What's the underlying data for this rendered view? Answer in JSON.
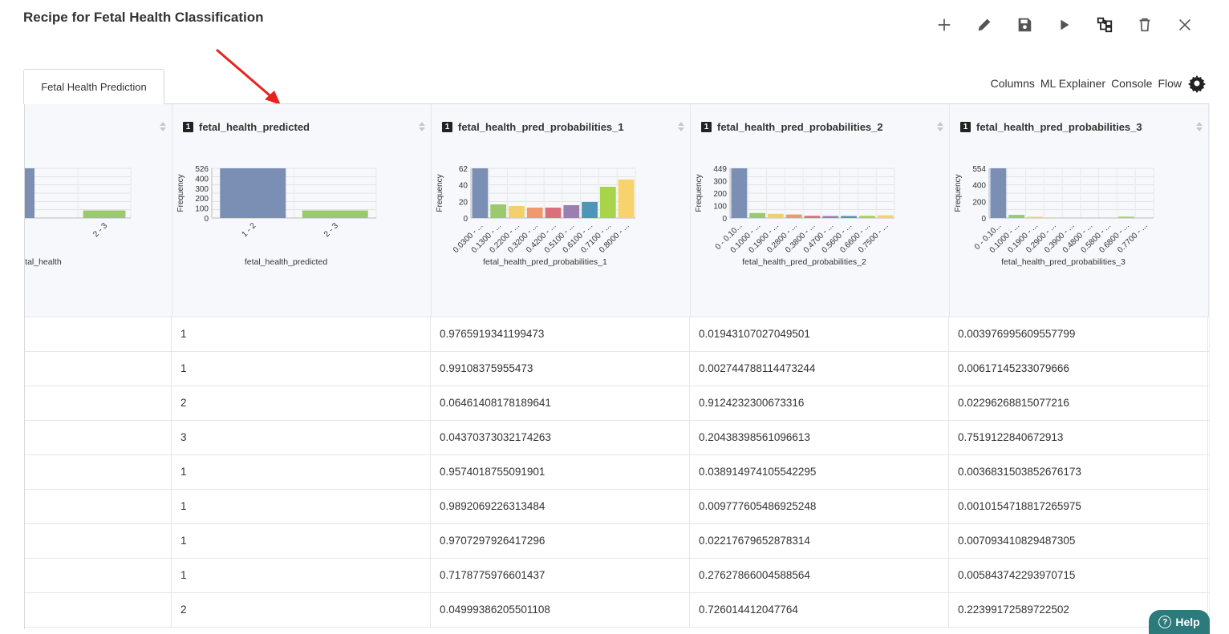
{
  "title": "Recipe for Fetal Health Classification",
  "toolbar": [
    "plus-icon",
    "pencil-icon",
    "save-icon",
    "play-icon",
    "flow-icon",
    "trash-icon",
    "close-icon"
  ],
  "tab": "Fetal Health Prediction",
  "links": {
    "columns": "Columns",
    "ml_explainer": "ML Explainer",
    "console": "Console",
    "flow": "Flow"
  },
  "type_badge": "1",
  "columns": [
    {
      "name": "",
      "xlabel": "etal_health",
      "ylabel": "",
      "chart": {
        "categories": [
          "",
          "2 - 3"
        ],
        "values": [
          526,
          80
        ],
        "ymax": 526,
        "yticks": [],
        "colors": [
          "#7b8fb5",
          "#9cc96e"
        ]
      }
    },
    {
      "name": "fetal_health_predicted",
      "xlabel": "fetal_health_predicted",
      "ylabel": "Frequency",
      "chart": {
        "categories": [
          "1 - 2",
          "2 - 3"
        ],
        "values": [
          526,
          80
        ],
        "ymax": 526,
        "yticks": [
          "526",
          "400",
          "300",
          "200",
          "100",
          "0"
        ],
        "colors": [
          "#7b8fb5",
          "#9cc96e"
        ]
      }
    },
    {
      "name": "fetal_health_pred_probabilities_1",
      "xlabel": "fetal_health_pred_probabilities_1",
      "ylabel": "Frequency",
      "chart": {
        "categories": [
          "0.0300 - ...",
          "0.1300 - ...",
          "0.2200 - ...",
          "0.3200 - ...",
          "0.4200 - ...",
          "0.5100 - ...",
          "0.6100 - ...",
          "0.7100 - ...",
          "0.8000 - ..."
        ],
        "values": [
          62,
          17,
          15,
          13,
          13,
          16,
          20,
          39,
          48
        ],
        "ymax": 62,
        "yticks": [
          "62",
          "40",
          "20",
          "0"
        ],
        "colors": [
          "#7b8fb5",
          "#9cc96e",
          "#f2d06b",
          "#ef9a6c",
          "#d9707c",
          "#9a7fb0",
          "#4c97b8",
          "#a8d44a",
          "#f6d36b"
        ]
      }
    },
    {
      "name": "fetal_health_pred_probabilities_2",
      "xlabel": "fetal_health_pred_probabilities_2",
      "ylabel": "Frequency",
      "chart": {
        "categories": [
          "0 - 0.10...",
          "0.1000 - ...",
          "0.1900 - ...",
          "0.2800 - ...",
          "0.3800 - ...",
          "0.4700 - ...",
          "0.5600 - ...",
          "0.6600 - ...",
          "0.7500 - ..."
        ],
        "values": [
          449,
          45,
          38,
          32,
          20,
          18,
          18,
          20,
          25
        ],
        "ymax": 449,
        "yticks": [
          "449",
          "300",
          "200",
          "100",
          "0"
        ],
        "colors": [
          "#7b8fb5",
          "#9cc96e",
          "#f2d06b",
          "#ef9a6c",
          "#d9707c",
          "#9a7fb0",
          "#4c97b8",
          "#a8d44a",
          "#f6d36b"
        ]
      }
    },
    {
      "name": "fetal_health_pred_probabilities_3",
      "xlabel": "fetal_health_pred_probabilities_3",
      "ylabel": "Frequency",
      "chart": {
        "categories": [
          "0 - 0.10...",
          "0.1000 - ...",
          "0.1900 - ...",
          "0.2900 - ...",
          "0.3900 - ...",
          "0.4800 - ...",
          "0.5800 - ...",
          "0.6800 - ...",
          "0.7700 - ..."
        ],
        "values": [
          554,
          35,
          14,
          0,
          0,
          0,
          0,
          15,
          0
        ],
        "ymax": 554,
        "yticks": [
          "554",
          "400",
          "200",
          "0"
        ],
        "colors": [
          "#7b8fb5",
          "#9cc96e",
          "#f2d06b",
          "#ef9a6c",
          "#d9707c",
          "#9a7fb0",
          "#4c97b8",
          "#a8d44a",
          "#f6d36b"
        ]
      }
    }
  ],
  "rows": [
    [
      "",
      "1",
      "0.9765919341199473",
      "0.01943107027049501",
      "0.003976995609557799"
    ],
    [
      "",
      "1",
      "0.99108375955473",
      "0.002744788114473244",
      "0.00617145233079666"
    ],
    [
      "",
      "2",
      "0.06461408178189641",
      "0.9124232300673316",
      "0.02296268815077216"
    ],
    [
      "",
      "3",
      "0.04370373032174263",
      "0.20438398561096613",
      "0.7519122840672913"
    ],
    [
      "",
      "1",
      "0.9574018755091901",
      "0.038914974105542295",
      "0.0036831503852676173"
    ],
    [
      "",
      "1",
      "0.9892069226313484",
      "0.009777605486925248",
      "0.0010154718817265975"
    ],
    [
      "",
      "1",
      "0.9707297926417296",
      "0.02217679652878314",
      "0.007093410829487305"
    ],
    [
      "",
      "1",
      "0.7178775976601437",
      "0.27627866004588564",
      "0.005843742293970715"
    ],
    [
      "",
      "2",
      "0.04999386205501108",
      "0.726014412047764",
      "0.22399172589722502"
    ]
  ],
  "help": "Help",
  "help_glyph": "?"
}
